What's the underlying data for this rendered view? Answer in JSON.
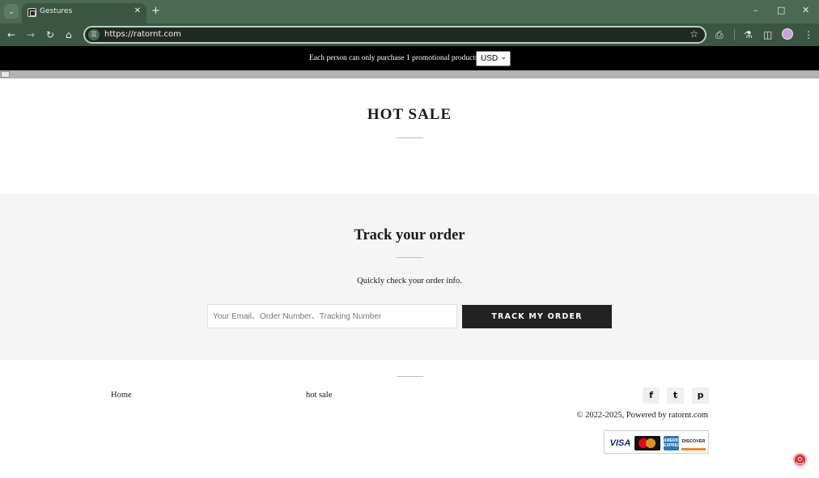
{
  "browser": {
    "tab_title": "Gestures",
    "url": "https://ratornt.com",
    "icons": {
      "tab_list": "chevron-down-icon",
      "tab_favicon": "favicon-icon",
      "tab_close": "close-icon",
      "new_tab": "plus-icon",
      "minimize": "minimize-icon",
      "maximize": "maximize-icon",
      "close_window": "close-icon",
      "back": "arrow-left-icon",
      "forward": "arrow-right-icon",
      "reload": "reload-icon",
      "home": "home-icon",
      "site_info": "tune-icon",
      "bookmark": "star-icon",
      "extensions": "puzzle-icon",
      "labs": "flask-icon",
      "side_panel": "side-panel-icon",
      "profile": "avatar",
      "menu": "kebab-menu-icon"
    },
    "colors": {
      "frame": "#4a6a54",
      "toolbar": "#3a5542",
      "omnibox_border": "#b8d2c0"
    }
  },
  "announcement": {
    "text": "Each person can only purchase 1 promotional products",
    "currency_selected": "USD"
  },
  "hot_sale": {
    "title": "HOT SALE"
  },
  "track_order": {
    "title": "Track your order",
    "subtitle": "Quickly check your order info.",
    "input_placeholder": "Your Email、Order Number、Tracking Number",
    "button_label": "TRACK MY ORDER"
  },
  "footer": {
    "links": [
      "Home",
      "hot sale"
    ],
    "social_icons": [
      "facebook-icon",
      "twitter-icon",
      "pinterest-icon"
    ],
    "social_glyphs": [
      "f",
      "t",
      "p"
    ],
    "copyright": "© 2022-2025, Powered by ratornt.com",
    "payment_icons": [
      "visa-icon",
      "mastercard-icon",
      "amex-icon",
      "discover-icon"
    ],
    "payment_text": {
      "visa": "VISA",
      "amex": "AMERICAN EXPRESS",
      "discover": "DISCOVER"
    }
  },
  "colors": {
    "announcement_bg": "#000000",
    "track_section_bg": "#f5f5f5",
    "button_bg": "#222222",
    "chat_widget": "#e8312f"
  }
}
